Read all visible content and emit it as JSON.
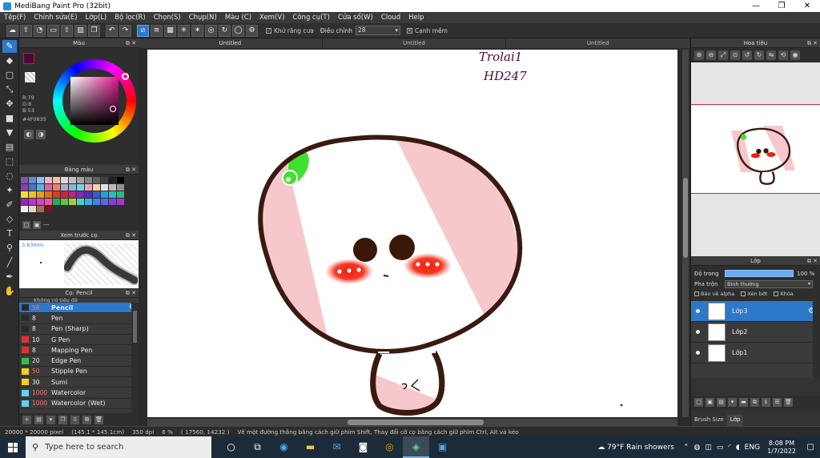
{
  "window": {
    "title": "MediBang Paint Pro (32bit)",
    "controls": [
      "—",
      "❐",
      "✕"
    ]
  },
  "menu": [
    "Tệp(F)",
    "Chỉnh sửa(E)",
    "Lớp(L)",
    "Bộ lọc(R)",
    "Chọn(S)",
    "Chụp(N)",
    "Màu (C)",
    "Xem(V)",
    "Công cụ(T)",
    "Cửa sổ(W)",
    "Cloud",
    "Help"
  ],
  "toolbar": {
    "antialias_label": "Khử răng cưa",
    "adjust_label": "Điều chỉnh",
    "adjust_value": "28",
    "edge_label": "Cạnh mềm"
  },
  "color_panel": {
    "title": "Màu",
    "r": "R:79",
    "g": "G:8",
    "b": "B:53",
    "hex": "#4F0835",
    "fg_color": "#4f0835"
  },
  "palette_panel": {
    "title": "Bảng màu",
    "colors": [
      "#7a5aa8",
      "#6a8ad8",
      "#8fc0e8",
      "#f0b0d0",
      "#f4c0a0",
      "#d8d8d8",
      "#c0c0c0",
      "#a0a0a0",
      "#808080",
      "#606060",
      "#404040",
      "#202020",
      "#000000",
      "#8c3fb0",
      "#5070c8",
      "#4bb8e8",
      "#e060a0",
      "#f08060",
      "#c0a0d0",
      "#90b0e0",
      "#70d0e8",
      "#f0a0c0",
      "#f8d0a0",
      "#e0e0e0",
      "#b8b8b8",
      "#909090",
      "#f2e030",
      "#f0c020",
      "#e8a010",
      "#e07010",
      "#d84020",
      "#d02040",
      "#c02080",
      "#9020c0",
      "#5030c0",
      "#3060d0",
      "#20a0e0",
      "#20c0c0",
      "#20c080",
      "#a020c0",
      "#c030d0",
      "#e040c0",
      "#f050a0",
      "#20b050",
      "#60c040",
      "#a0d030",
      "#40d0d0",
      "#30b0f0",
      "#4080f0",
      "#6060f0",
      "#8040e0",
      "#b030d0",
      "#f0f0f0",
      "#e8d8b0",
      "#a07050",
      "#7a1020"
    ],
    "dash": "---"
  },
  "brush_preview": {
    "title": "Xem trước cọ",
    "size": "3.63mm"
  },
  "brush_panel": {
    "title": "Cọ: Pencil",
    "cut_text": "Không có tiêu đề",
    "items": [
      {
        "size": "58",
        "name": "Pencil",
        "color": "#2a2a2a",
        "selected": true
      },
      {
        "size": "8",
        "name": "Pen",
        "color": "#2a2a2a"
      },
      {
        "size": "8",
        "name": "Pen (Sharp)",
        "color": "#2a2a2a"
      },
      {
        "size": "10",
        "name": "G Pen",
        "color": "#e03030"
      },
      {
        "size": "8",
        "name": "Mapping Pen",
        "color": "#e03030"
      },
      {
        "size": "20",
        "name": "Edge Pen",
        "color": "#30c040"
      },
      {
        "size": "50",
        "name": "Stipple Pen",
        "color": "#f0d020"
      },
      {
        "size": "30",
        "name": "Sumi",
        "color": "#f0d020"
      },
      {
        "size": "1000",
        "name": "Watercolor",
        "color": "#60d0f0"
      },
      {
        "size": "1000",
        "name": "Watercolor (Wet)",
        "color": "#60d0f0"
      }
    ]
  },
  "doc_tabs": [
    "Untitled",
    "Untitled",
    "Untitled"
  ],
  "canvas": {
    "handwriting_line1": "Trolai1",
    "handwriting_line2": "HD247"
  },
  "navigator": {
    "title": "Hoa tiêu"
  },
  "layer_panel": {
    "title": "Lớp",
    "opacity_label": "Độ trong",
    "opacity_value": "100 %",
    "opacity_fraction": 1.0,
    "blend_label": "Pha trộn",
    "blend_value": "Bình thường",
    "protect_alpha": "Bảo vệ alpha",
    "clip": "Xén bớt",
    "lock": "Khóa",
    "layers": [
      {
        "name": "Lớp3",
        "selected": true
      },
      {
        "name": "Lớp2",
        "selected": false
      },
      {
        "name": "Lớp1",
        "selected": false
      }
    ]
  },
  "right_tabs": [
    "Brush Size",
    "Lớp"
  ],
  "statusbar": {
    "size": "20000 * 20000 pixel",
    "dims": "(145.1 * 145.1cm)",
    "dpi": "350 dpi",
    "zoom": "6 %",
    "coords": "( 17560, 14232 )",
    "hint": "Vẽ một đường thẳng bằng cách giữ phím Shift, Thay đổi cỡ cọ bằng cách giữ phím Ctrl, Alt và kéo"
  },
  "taskbar": {
    "search_placeholder": "Type here to search",
    "weather": "79°F  Rain showers",
    "lang": "ENG",
    "time": "8:08 PM",
    "date": "1/7/2022"
  }
}
